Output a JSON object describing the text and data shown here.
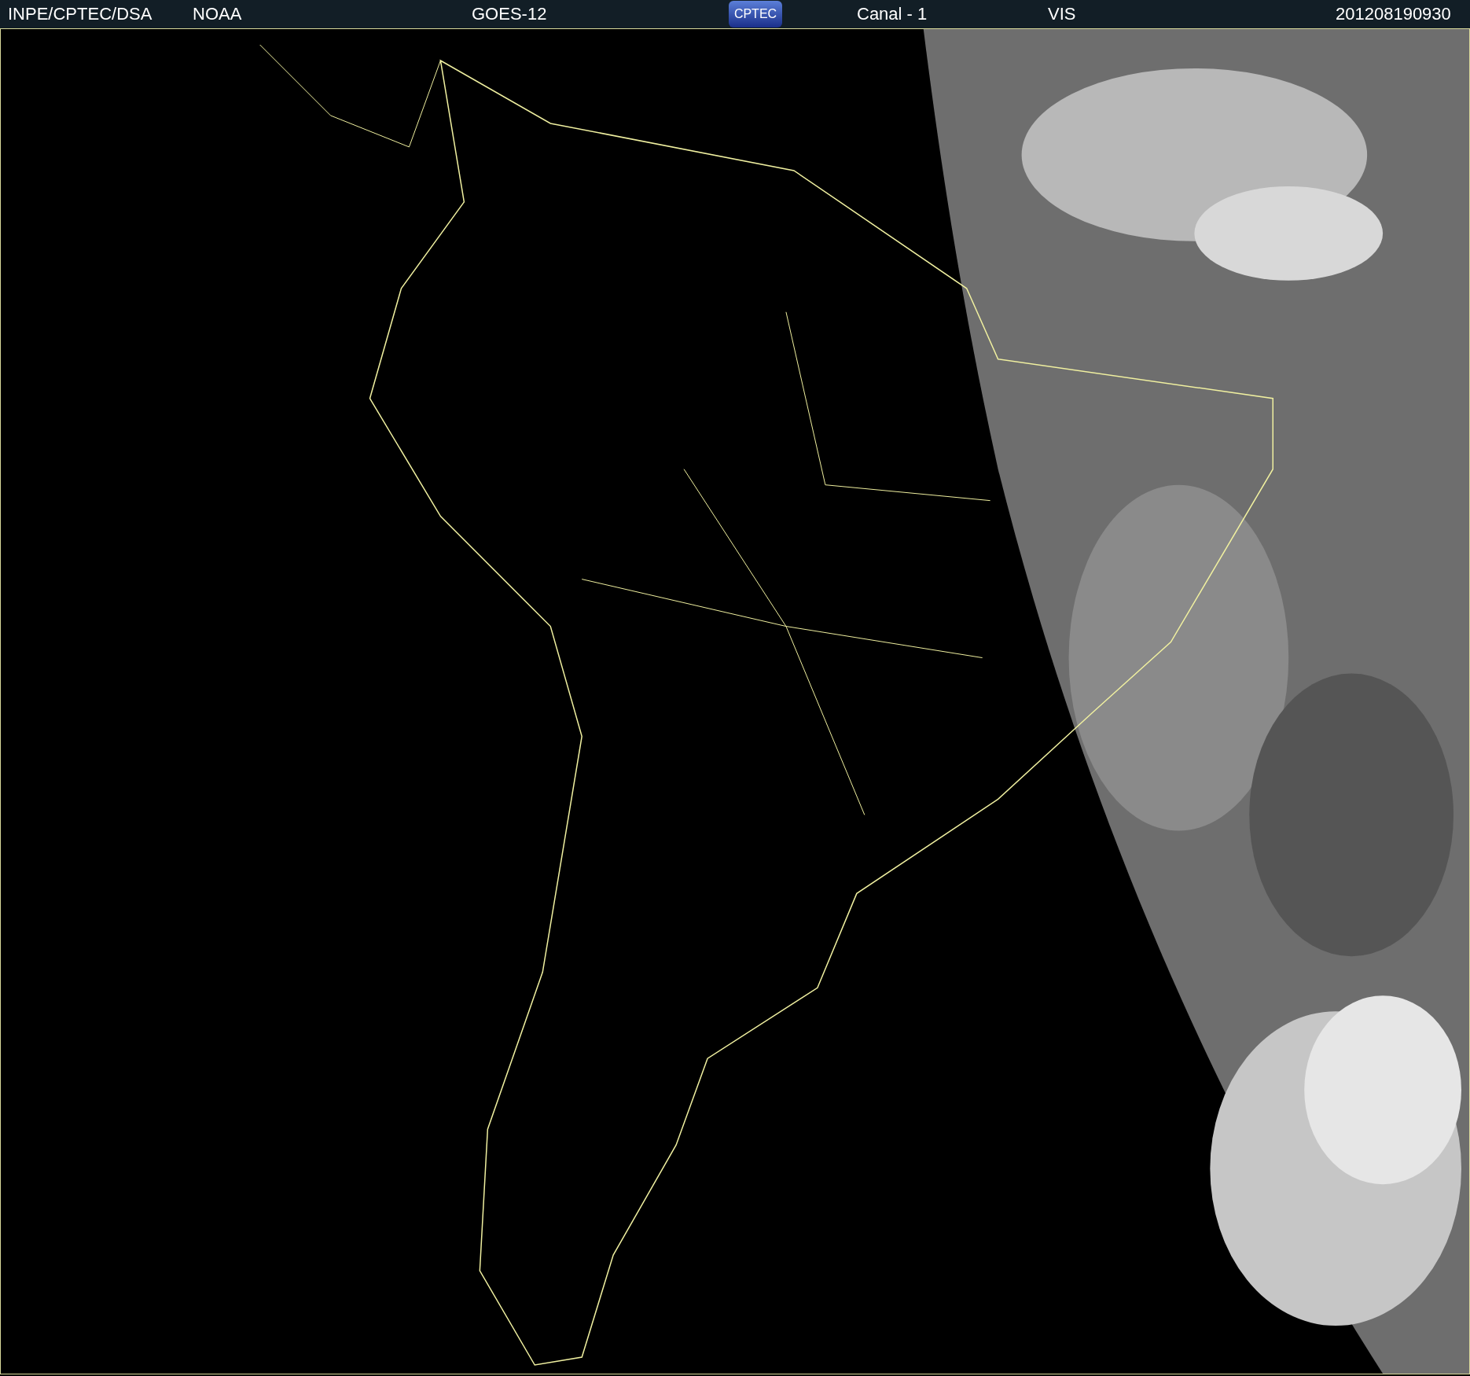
{
  "header": {
    "source": "INPE/CPTEC/DSA",
    "agency": "NOAA",
    "satellite": "GOES-12",
    "logo": "CPTEC",
    "channel": "Canal - 1",
    "band": "VIS",
    "timestamp": "201208190930"
  }
}
